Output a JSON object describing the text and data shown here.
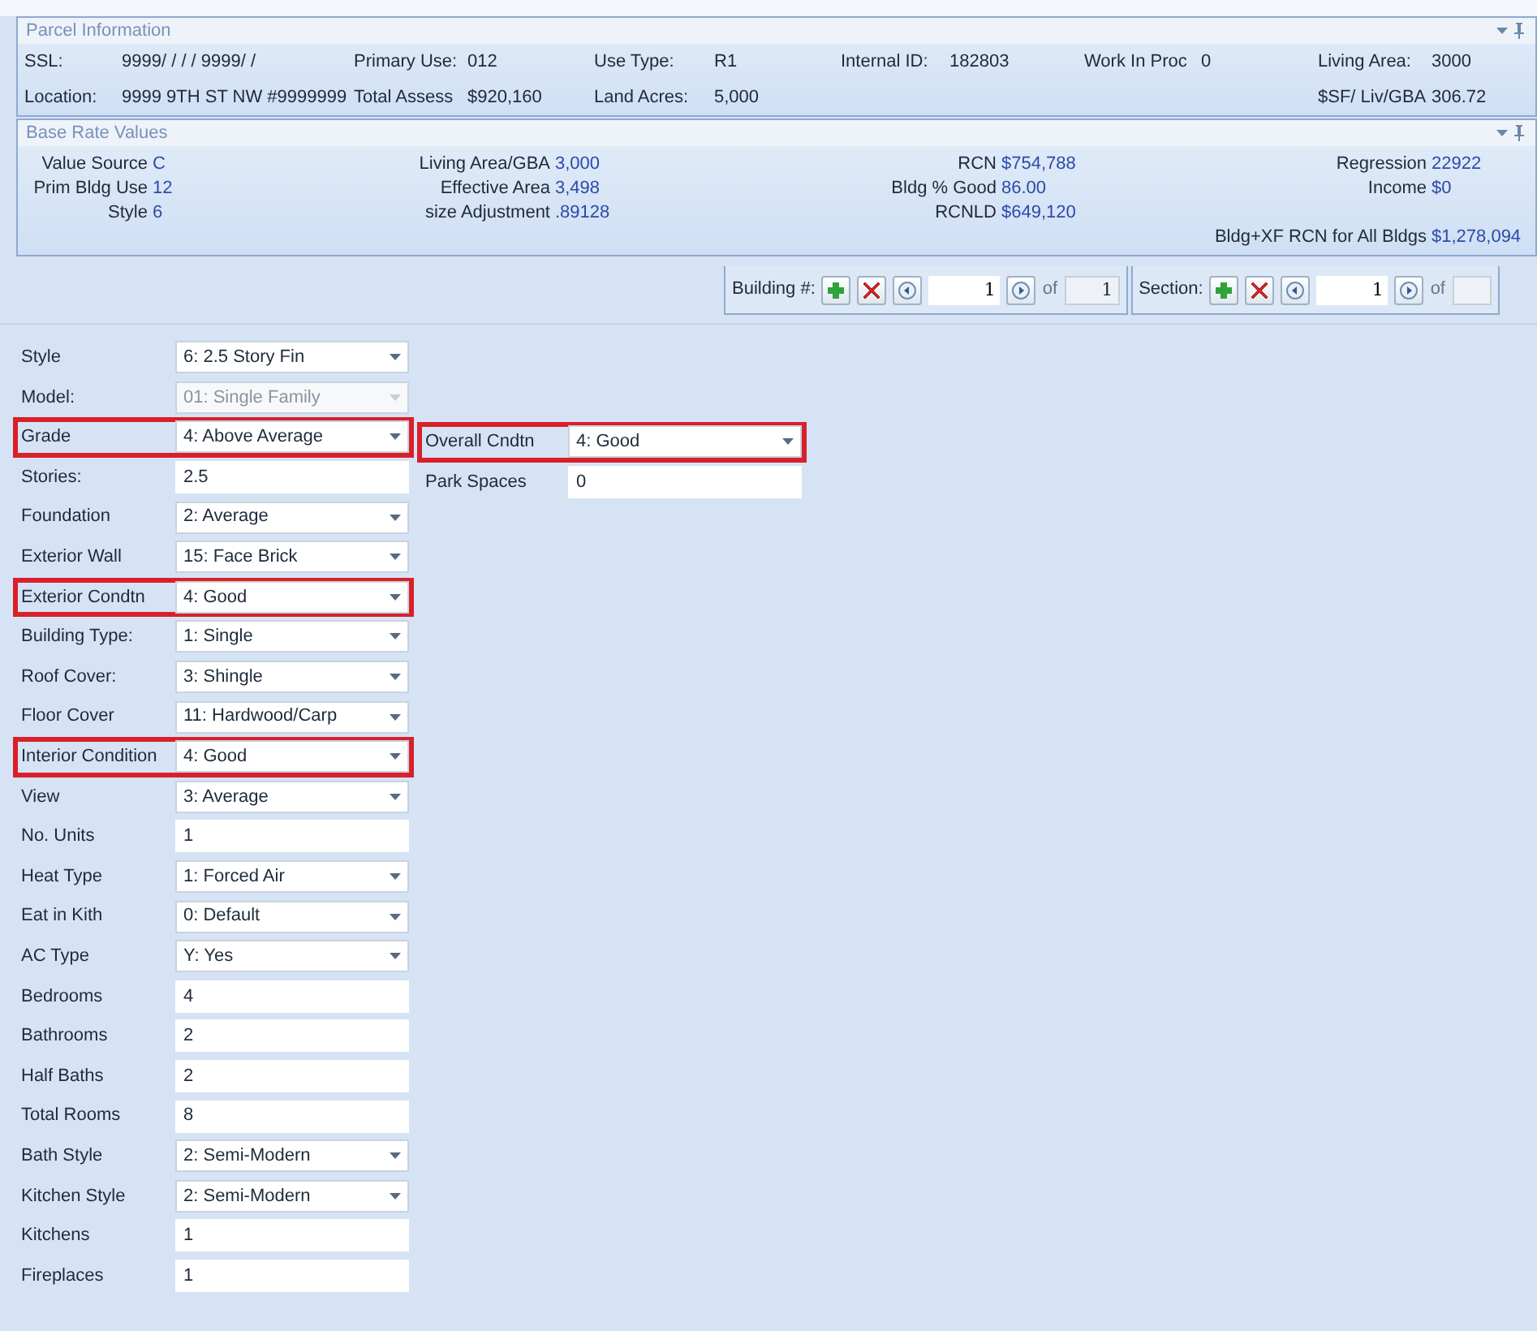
{
  "parcel_info": {
    "title": "Parcel Information",
    "rows": [
      [
        {
          "label": "SSL:",
          "value": "9999/ /     / / 9999/ /"
        },
        {
          "label": "Primary Use:",
          "value": "012"
        },
        {
          "label": "Use Type:",
          "value": "R1"
        },
        {
          "label": "Internal ID:",
          "value": "182803"
        },
        {
          "label": "Work In Proc",
          "value": "0"
        },
        {
          "label": "Living Area:",
          "value": "3000"
        }
      ],
      [
        {
          "label": "Location:",
          "value": "9999 9TH ST NW #9999999"
        },
        {
          "label": "Total Assess",
          "value": "$920,160"
        },
        {
          "label": "Land Acres:",
          "value": "5,000"
        },
        null,
        null,
        {
          "label": "$SF/ Liv/GBA",
          "value": "306.72"
        }
      ]
    ]
  },
  "base_rate_values": {
    "title": "Base Rate Values",
    "columns": [
      [
        {
          "label": "Value Source",
          "value": "C"
        },
        {
          "label": "Prim Bldg Use",
          "value": "12"
        },
        {
          "label": "Style",
          "value": "6"
        }
      ],
      [
        {
          "label": "Living Area/GBA",
          "value": "3,000"
        },
        {
          "label": "Effective Area",
          "value": "3,498"
        },
        {
          "label": "size Adjustment",
          "value": ".89128"
        }
      ],
      [
        {
          "label": "RCN",
          "value": "$754,788"
        },
        {
          "label": "Bldg % Good",
          "value": "86.00"
        },
        {
          "label": "RCNLD",
          "value": "$649,120"
        }
      ],
      [
        {
          "label": "Regression",
          "value": "22922"
        },
        {
          "label": "Income",
          "value": "$0"
        },
        {
          "label": "Bldg+XF RCN for All Bldgs",
          "value": "$1,278,094"
        }
      ]
    ]
  },
  "navigators": [
    {
      "label": "Building #:",
      "current": "1",
      "of": "of",
      "total": "1"
    },
    {
      "label": "Section:",
      "current": "1",
      "of": "of"
    }
  ],
  "form": {
    "left": [
      {
        "label": "Style",
        "kind": "select",
        "value": "6: 2.5 Story Fin",
        "disabled": false,
        "highlighted": false
      },
      {
        "label": "Model:",
        "kind": "select",
        "value": "01: Single Family",
        "disabled": true,
        "highlighted": false
      },
      {
        "label": "Grade",
        "kind": "select",
        "value": "4: Above Average",
        "disabled": false,
        "highlighted": true
      },
      {
        "label": "Stories:",
        "kind": "text",
        "value": "2.5",
        "disabled": false,
        "highlighted": false
      },
      {
        "label": "Foundation",
        "kind": "select",
        "value": "2: Average",
        "disabled": false,
        "highlighted": false
      },
      {
        "label": "Exterior Wall",
        "kind": "select",
        "value": "15: Face Brick",
        "disabled": false,
        "highlighted": false
      },
      {
        "label": "Exterior Condtn",
        "kind": "select",
        "value": "4: Good",
        "disabled": false,
        "highlighted": true
      },
      {
        "label": "Building Type:",
        "kind": "select",
        "value": "1: Single",
        "disabled": false,
        "highlighted": false
      },
      {
        "label": "Roof Cover:",
        "kind": "select",
        "value": "3: Shingle",
        "disabled": false,
        "highlighted": false
      },
      {
        "label": "Floor Cover",
        "kind": "select",
        "value": "11: Hardwood/Carp",
        "disabled": false,
        "highlighted": false
      },
      {
        "label": "Interior Condition",
        "kind": "select",
        "value": "4: Good",
        "disabled": false,
        "highlighted": true
      },
      {
        "label": "View",
        "kind": "select",
        "value": "3: Average",
        "disabled": false,
        "highlighted": false
      },
      {
        "label": "No. Units",
        "kind": "text",
        "value": "1",
        "disabled": false,
        "highlighted": false
      },
      {
        "label": "Heat Type",
        "kind": "select",
        "value": "1: Forced Air",
        "disabled": false,
        "highlighted": false
      },
      {
        "label": "Eat in Kith",
        "kind": "select",
        "value": "0: Default",
        "disabled": false,
        "highlighted": false
      },
      {
        "label": "AC Type",
        "kind": "select",
        "value": "Y: Yes",
        "disabled": false,
        "highlighted": false
      },
      {
        "label": "Bedrooms",
        "kind": "text",
        "value": "4",
        "disabled": false,
        "highlighted": false
      },
      {
        "label": "Bathrooms",
        "kind": "text",
        "value": "2",
        "disabled": false,
        "highlighted": false
      },
      {
        "label": "Half Baths",
        "kind": "text",
        "value": "2",
        "disabled": false,
        "highlighted": false
      },
      {
        "label": "Total Rooms",
        "kind": "text",
        "value": "8",
        "disabled": false,
        "highlighted": false
      },
      {
        "label": "Bath Style",
        "kind": "select",
        "value": "2: Semi-Modern",
        "disabled": false,
        "highlighted": false
      },
      {
        "label": "Kitchen Style",
        "kind": "select",
        "value": "2: Semi-Modern",
        "disabled": false,
        "highlighted": false
      },
      {
        "label": "Kitchens",
        "kind": "text",
        "value": "1",
        "disabled": false,
        "highlighted": false
      },
      {
        "label": "Fireplaces",
        "kind": "text",
        "value": "1",
        "disabled": false,
        "highlighted": false
      }
    ],
    "right": [
      {
        "label": "Overall Cndtn",
        "kind": "select",
        "value": "4: Good",
        "disabled": false,
        "highlighted": true
      },
      {
        "label": "Park Spaces",
        "kind": "text",
        "value": "0",
        "disabled": false,
        "highlighted": false
      }
    ]
  }
}
